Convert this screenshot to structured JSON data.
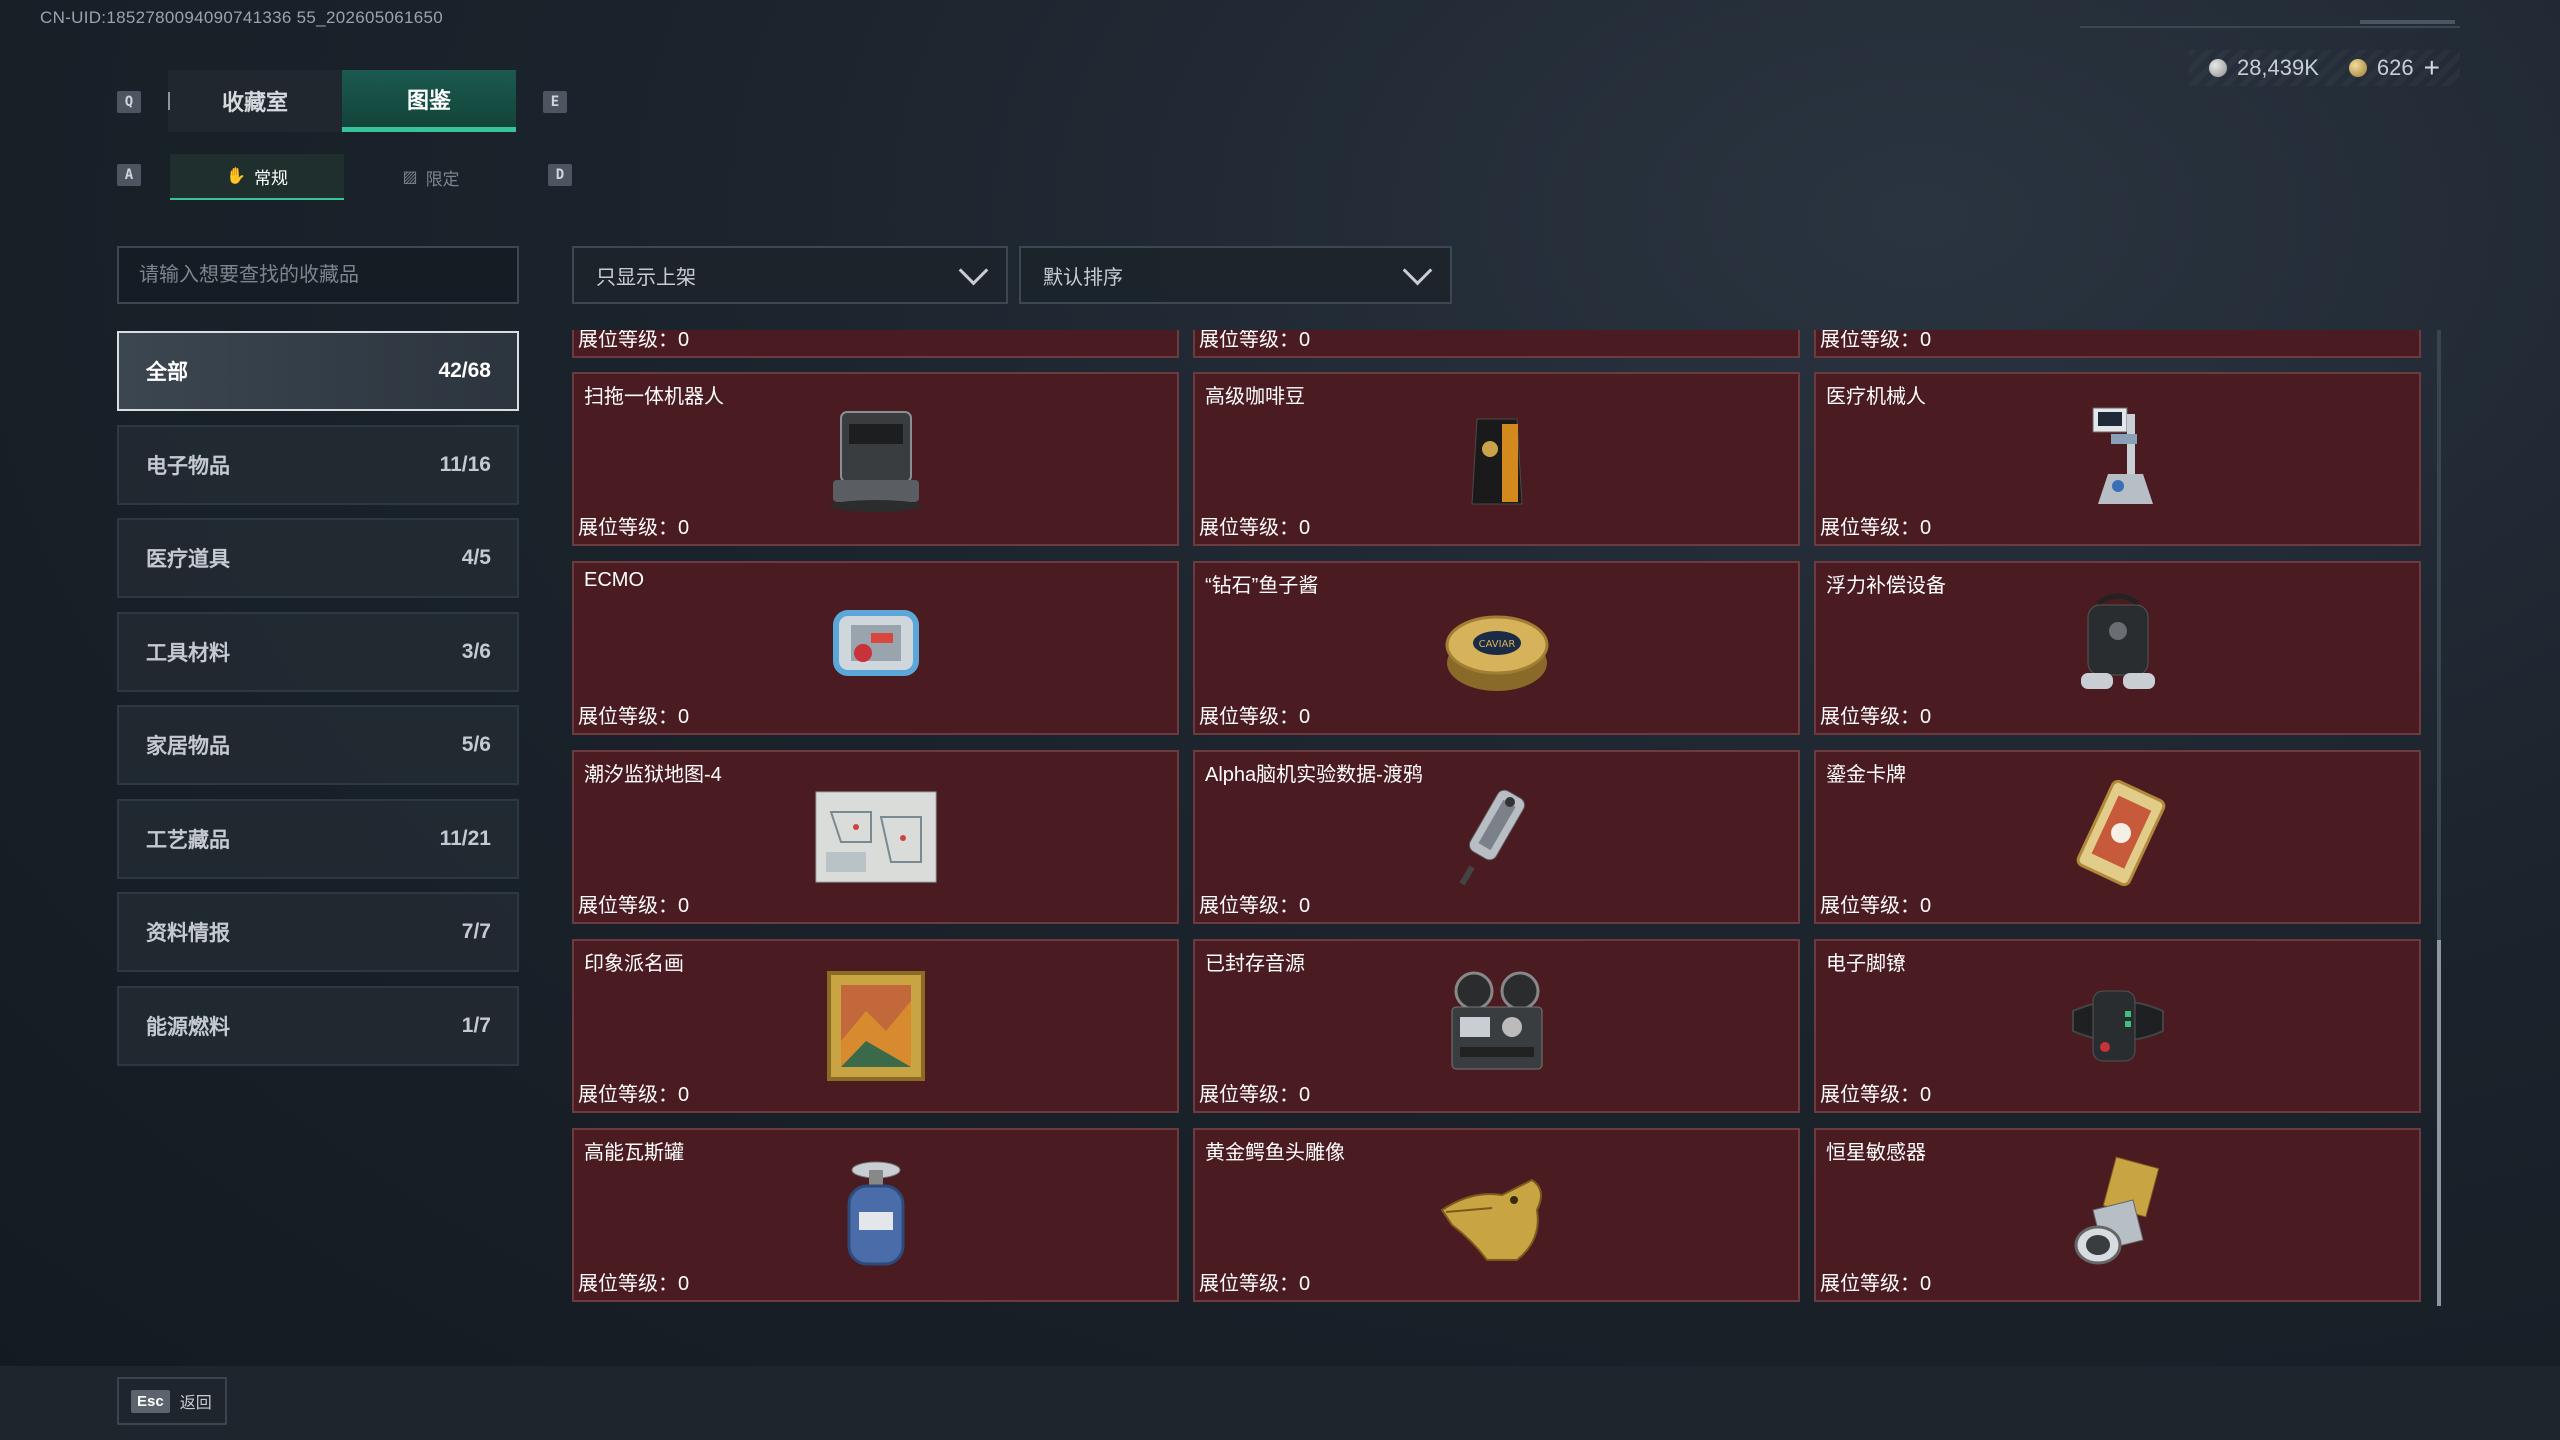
{
  "uid_text": "CN-UID:1852780094090741336 55_202605061650",
  "currency": {
    "silver": "28,439K",
    "gold": "626",
    "plus": "+"
  },
  "keys": {
    "prev_main": "Q",
    "next_main": "E",
    "prev_sub": "A",
    "next_sub": "D"
  },
  "tabs_main": [
    {
      "label": "收藏室",
      "active": false
    },
    {
      "label": "图鉴",
      "active": true
    }
  ],
  "tabs_sub": [
    {
      "label": "常规",
      "active": true
    },
    {
      "label": "限定",
      "active": false
    }
  ],
  "search": {
    "placeholder": "请输入想要查找的收藏品"
  },
  "filters": {
    "display": "只显示上架",
    "sort": "默认排序"
  },
  "categories": [
    {
      "label": "全部",
      "count": "42/68",
      "active": true
    },
    {
      "label": "电子物品",
      "count": "11/16"
    },
    {
      "label": "医疗道具",
      "count": "4/5"
    },
    {
      "label": "工具材料",
      "count": "3/6"
    },
    {
      "label": "家居物品",
      "count": "5/6"
    },
    {
      "label": "工艺藏品",
      "count": "11/21"
    },
    {
      "label": "资料情报",
      "count": "7/7"
    },
    {
      "label": "能源燃料",
      "count": "1/7"
    }
  ],
  "level_label": "展位等级：",
  "items": [
    {
      "name": "",
      "level": "0",
      "icon": "partial-item"
    },
    {
      "name": "",
      "level": "0",
      "icon": "partial-item"
    },
    {
      "name": "",
      "level": "0",
      "icon": "partial-item"
    },
    {
      "name": "扫拖一体机器人",
      "level": "0",
      "icon": "robot-vacuum-icon"
    },
    {
      "name": "高级咖啡豆",
      "level": "0",
      "icon": "coffee-bag-icon"
    },
    {
      "name": "医疗机械人",
      "level": "0",
      "icon": "medical-robot-icon"
    },
    {
      "name": "ECMO",
      "level": "0",
      "icon": "ecmo-machine-icon"
    },
    {
      "name": "“钻石”鱼子酱",
      "level": "0",
      "icon": "caviar-tin-icon"
    },
    {
      "name": "浮力补偿设备",
      "level": "0",
      "icon": "buoyancy-vest-icon"
    },
    {
      "name": "潮汐监狱地图-4",
      "level": "0",
      "icon": "prison-map-icon"
    },
    {
      "name": "Alpha脑机实验数据-渡鸦",
      "level": "0",
      "icon": "data-drive-icon"
    },
    {
      "name": "鎏金卡牌",
      "level": "0",
      "icon": "gilded-card-icon"
    },
    {
      "name": "印象派名画",
      "level": "0",
      "icon": "painting-icon"
    },
    {
      "name": "已封存音源",
      "level": "0",
      "icon": "tape-recorder-icon"
    },
    {
      "name": "电子脚镣",
      "level": "0",
      "icon": "ankle-monitor-icon"
    },
    {
      "name": "高能瓦斯罐",
      "level": "0",
      "icon": "gas-canister-icon"
    },
    {
      "name": "黄金鳄鱼头雕像",
      "level": "0",
      "icon": "gold-crocodile-icon"
    },
    {
      "name": "恒星敏感器",
      "level": "0",
      "icon": "star-sensor-icon"
    }
  ],
  "esc": {
    "key": "Esc",
    "label": "返回"
  },
  "colors": {
    "accent": "#37c49a",
    "card_bg": "#4a1b20",
    "card_border": "#6c3a3f"
  }
}
